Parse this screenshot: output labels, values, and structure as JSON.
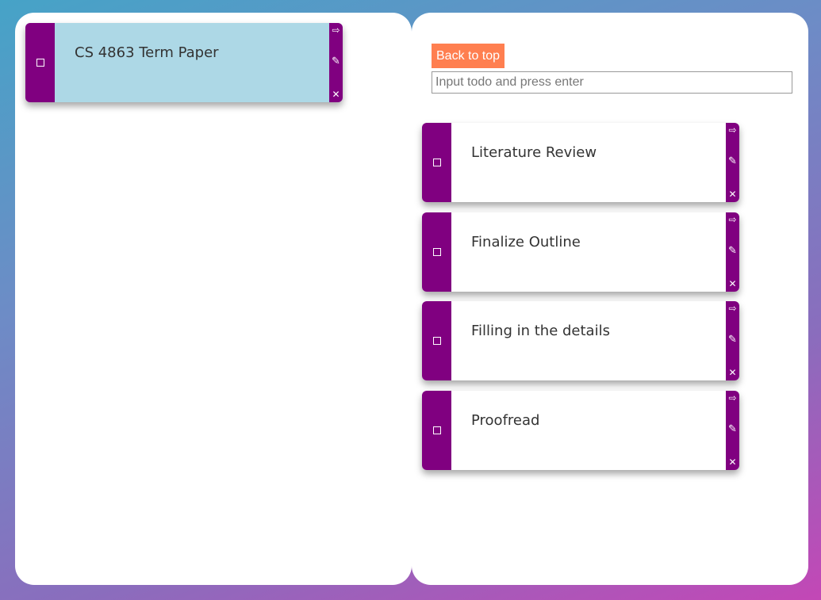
{
  "left_panel": {
    "cards": [
      {
        "title": "CS 4863 Term Paper"
      }
    ]
  },
  "right_panel": {
    "back_to_top_label": "Back to top",
    "todo_input": {
      "value": "",
      "placeholder": "Input todo and press enter"
    },
    "cards": [
      {
        "title": "Literature Review"
      },
      {
        "title": "Finalize Outline"
      },
      {
        "title": "Filling in the details"
      },
      {
        "title": "Proofread"
      }
    ]
  },
  "icons": {
    "checkbox": "checkbox-icon",
    "move": "arrow-right-icon",
    "edit": "pencil-icon",
    "delete": "close-icon"
  },
  "colors": {
    "accent": "#800080",
    "highlight_card": "#add8e6",
    "button": "#ff7f50",
    "card": "#ffffff"
  }
}
